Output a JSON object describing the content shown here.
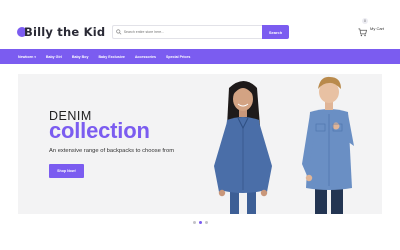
{
  "header": {
    "logo_text": "Billy the Kid",
    "search_placeholder": "Search entire store here...",
    "search_button": "Search",
    "cart_count": "0",
    "cart_label": "My Cart"
  },
  "nav": {
    "items": [
      {
        "label": "Newborn",
        "has_dropdown": true
      },
      {
        "label": "Baby Girl"
      },
      {
        "label": "Baby Boy"
      },
      {
        "label": "Baby Exclusive"
      },
      {
        "label": "Accessories"
      },
      {
        "label": "Special Prices"
      }
    ]
  },
  "hero": {
    "subtitle": "DENIM",
    "title": "collection",
    "description": "An extensive range of backpacks to choose from",
    "button_label": "Shop Now!"
  },
  "slider": {
    "total": 3,
    "active": 2
  },
  "colors": {
    "accent": "#7b5cf0",
    "text": "#222222",
    "hero_bg": "#f3f3f4"
  }
}
